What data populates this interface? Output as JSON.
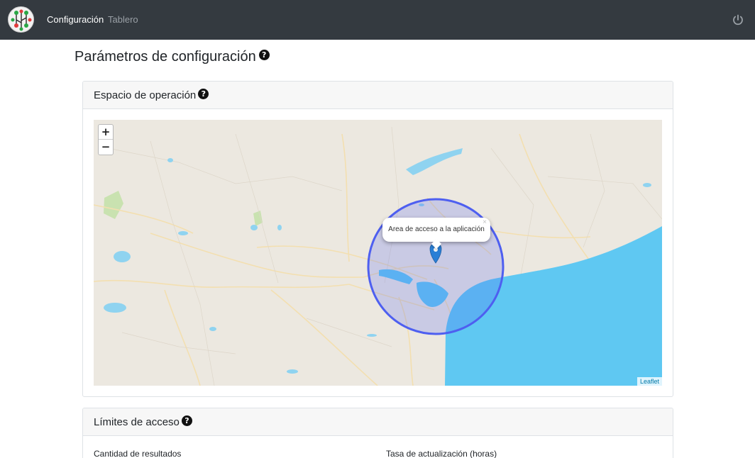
{
  "navbar": {
    "logo": "circuit-tree-logo",
    "links": [
      "Configuración",
      "Tablero"
    ],
    "power_icon": "power-icon"
  },
  "page": {
    "title": "Parámetros de configuración"
  },
  "cards": {
    "operation": {
      "title": "Espacio de operación",
      "map": {
        "zoom_in": "+",
        "zoom_out": "−",
        "popup_text": "Area de acceso a la aplicación",
        "popup_close": "×",
        "attribution": "Leaflet",
        "circle_color": "#4e5ff0",
        "water_color": "#5fc8f2",
        "land_color": "#ece8e0"
      }
    },
    "limits": {
      "title": "Límites de acceso",
      "fields": [
        "Cantidad de resultados",
        "Tasa de actualización (horas)"
      ]
    }
  }
}
